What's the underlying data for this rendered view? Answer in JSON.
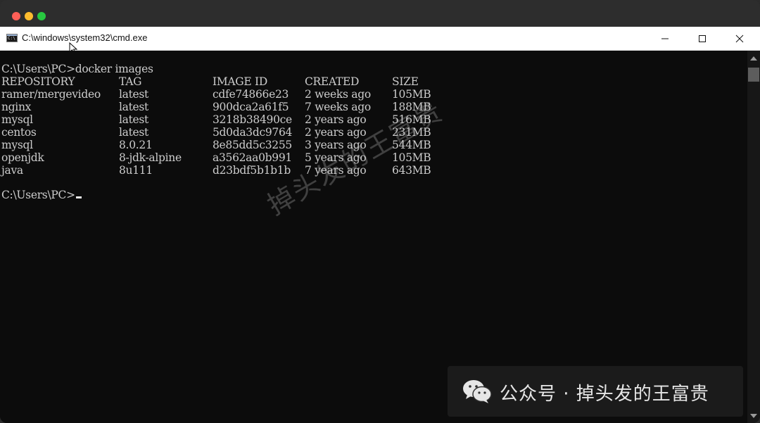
{
  "window": {
    "title": "C:\\windows\\system32\\cmd.exe"
  },
  "terminal": {
    "command_line": "C:\\Users\\PC>docker images",
    "columns": [
      "REPOSITORY",
      "TAG",
      "IMAGE ID",
      "CREATED",
      "SIZE"
    ],
    "rows": [
      [
        "ramer/mergevideo",
        "latest",
        "cdfe74866e23",
        "2 weeks ago",
        "105MB"
      ],
      [
        "nginx",
        "latest",
        "900dca2a61f5",
        "7 weeks ago",
        "188MB"
      ],
      [
        "mysql",
        "latest",
        "3218b38490ce",
        "2 years ago",
        "516MB"
      ],
      [
        "centos",
        "latest",
        "5d0da3dc9764",
        "2 years ago",
        "231MB"
      ],
      [
        "mysql",
        "8.0.21",
        "8e85dd5c3255",
        "3 years ago",
        "544MB"
      ],
      [
        "openjdk",
        "8-jdk-alpine",
        "a3562aa0b991",
        "5 years ago",
        "105MB"
      ],
      [
        "java",
        "8u111",
        "d23bdf5b1b1b",
        "7 years ago",
        "643MB"
      ]
    ],
    "prompt": "C:\\Users\\PC>"
  },
  "watermark": {
    "diagonal": "掉头发的王富贵",
    "bottom": "公众号 · 掉头发的王富贵"
  },
  "icons": {
    "app": "cmd-icon",
    "minimize": "minimize-icon",
    "maximize": "maximize-icon",
    "close": "close-icon",
    "wechat": "wechat-icon"
  },
  "colors": {
    "terminal_bg": "#0c0c0c",
    "terminal_fg": "#cccccc",
    "titlebar_bg": "#ffffff"
  }
}
